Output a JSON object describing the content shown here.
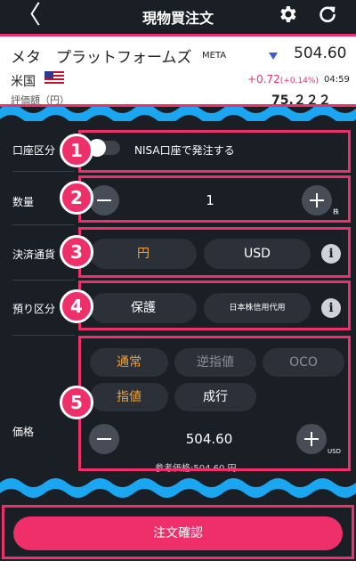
{
  "header": {
    "back_label": "〈",
    "title": "現物買注文",
    "settings_icon": "gear-icon",
    "refresh_icon": "refresh-icon"
  },
  "stock": {
    "name": "メタ　プラットフォームズ",
    "ticker": "META",
    "price": "504.60",
    "country": "米国",
    "change": "+0.72",
    "change_pct": "(+0.14%)",
    "time": "04:59",
    "partial_label": "評価額（円）",
    "partial_value": "75,２２２",
    "trend_color": "#3a5bd9"
  },
  "form": {
    "account": {
      "label": "口座区分",
      "nisa_text": "NISA口座で発注する",
      "nisa_enabled": false
    },
    "quantity": {
      "label": "数量",
      "value": "1",
      "unit": "株"
    },
    "currency": {
      "label": "決済通貨",
      "options": [
        "円",
        "USD"
      ],
      "selected": "円"
    },
    "deposit": {
      "label": "預り区分",
      "options": [
        "保護",
        "日本株信用代用"
      ],
      "selected": "保護"
    },
    "price": {
      "label": "価格",
      "order_types": [
        "通常",
        "逆指値",
        "OCO"
      ],
      "selected_order_type": "通常",
      "price_types": [
        "指値",
        "成行"
      ],
      "selected_price_type": "指値",
      "value": "504.60",
      "unit": "USD",
      "reference": "参考価格:504.60 円"
    }
  },
  "badges": [
    "1",
    "2",
    "3",
    "4",
    "5"
  ],
  "footer": {
    "confirm_label": "注文確認"
  },
  "colors": {
    "accent": "#ee2f6a",
    "selected_text": "#f4a233",
    "background": "#1a1e25",
    "pill": "#2b3039",
    "wave": "#1aa6f0"
  }
}
